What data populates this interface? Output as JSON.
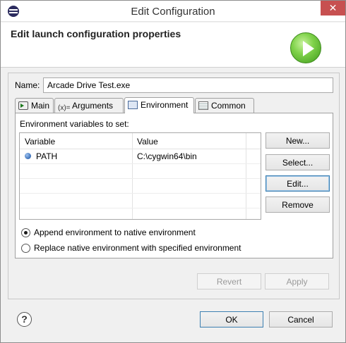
{
  "window": {
    "title": "Edit Configuration",
    "close_glyph": "✕"
  },
  "banner": {
    "title": "Edit launch configuration properties",
    "icon": "run-icon"
  },
  "name": {
    "label": "Name:",
    "value": "Arcade Drive Test.exe"
  },
  "tabs": [
    {
      "label": "Main",
      "icon": "main-icon"
    },
    {
      "label": "Arguments",
      "icon": "arguments-icon",
      "icon_text": "(x)="
    },
    {
      "label": "Environment",
      "icon": "environment-icon",
      "active": true
    },
    {
      "label": "Common",
      "icon": "common-icon"
    }
  ],
  "environment": {
    "label": "Environment variables to set:",
    "columns": [
      "Variable",
      "Value"
    ],
    "rows": [
      {
        "variable": "PATH",
        "value": "C:\\cygwin64\\bin"
      }
    ],
    "buttons": {
      "new": "New...",
      "select": "Select...",
      "edit": "Edit...",
      "remove": "Remove"
    },
    "radio_append": "Append environment to native environment",
    "radio_replace": "Replace native environment with specified environment",
    "selected_mode": "append"
  },
  "panel_buttons": {
    "revert": "Revert",
    "apply": "Apply"
  },
  "dialog_buttons": {
    "ok": "OK",
    "cancel": "Cancel"
  },
  "help": {
    "glyph": "?"
  },
  "colors": {
    "close": "#c75050",
    "accent": "#3c7fb1",
    "run_green": "#7fd24a"
  }
}
